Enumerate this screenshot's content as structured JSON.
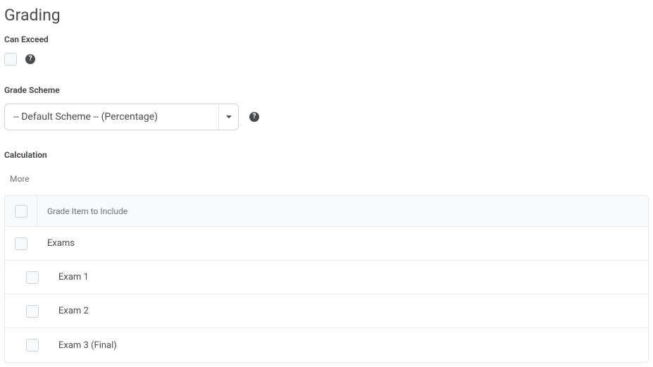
{
  "title": "Grading",
  "can_exceed": {
    "label": "Can Exceed"
  },
  "grade_scheme": {
    "label": "Grade Scheme",
    "value": "-- Default Scheme -- (Percentage)"
  },
  "calculation": {
    "label": "Calculation",
    "more": "More",
    "header": "Grade Item to Include",
    "rows": [
      {
        "label": "Exams",
        "indent": false
      },
      {
        "label": "Exam 1",
        "indent": true
      },
      {
        "label": "Exam 2",
        "indent": true
      },
      {
        "label": "Exam 3 (Final)",
        "indent": true
      }
    ]
  }
}
